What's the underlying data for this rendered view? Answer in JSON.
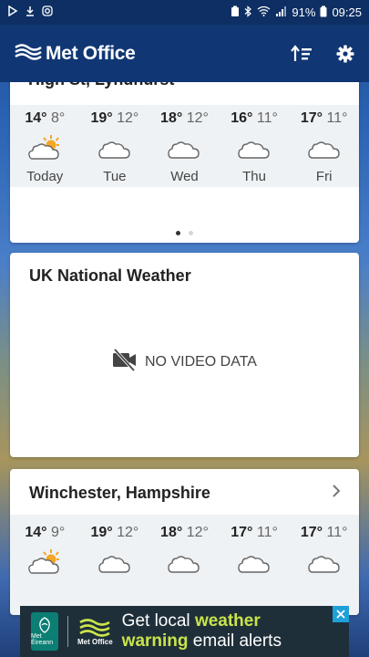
{
  "status_bar": {
    "left_icons": [
      "play-store-icon",
      "download-icon",
      "instagram-icon"
    ],
    "right_icons": [
      "battery-saver-icon",
      "bluetooth-icon",
      "wifi-icon",
      "signal-icon",
      "battery-icon"
    ],
    "battery": "91%",
    "time": "09:25"
  },
  "app_bar": {
    "title": "Met Office",
    "actions": [
      "sort-icon",
      "settings-icon"
    ]
  },
  "card1": {
    "header": "High St, Lyndhurst",
    "days": [
      {
        "hi": "14°",
        "lo": "8°",
        "icon": "sunny-intervals-icon",
        "name": "Today"
      },
      {
        "hi": "19°",
        "lo": "12°",
        "icon": "cloud-icon",
        "name": "Tue"
      },
      {
        "hi": "18°",
        "lo": "12°",
        "icon": "cloud-icon",
        "name": "Wed"
      },
      {
        "hi": "16°",
        "lo": "11°",
        "icon": "cloud-icon",
        "name": "Thu"
      },
      {
        "hi": "17°",
        "lo": "11°",
        "icon": "cloud-icon",
        "name": "Fri"
      }
    ],
    "page_dots": {
      "count": 2,
      "active": 0
    }
  },
  "card2": {
    "title": "UK National Weather",
    "no_video_label": "NO VIDEO DATA"
  },
  "card3": {
    "title": "Winchester, Hampshire",
    "days": [
      {
        "hi": "14°",
        "lo": "9°",
        "icon": "sunny-intervals-icon"
      },
      {
        "hi": "19°",
        "lo": "12°",
        "icon": "cloud-icon"
      },
      {
        "hi": "18°",
        "lo": "12°",
        "icon": "cloud-icon"
      },
      {
        "hi": "17°",
        "lo": "11°",
        "icon": "cloud-icon"
      },
      {
        "hi": "17°",
        "lo": "11°",
        "icon": "cloud-icon"
      }
    ]
  },
  "ad": {
    "badge_text": "Met Éireann",
    "logo_text": "Met Office",
    "line1_prefix": "Get local ",
    "line1_highlight": "weather",
    "line2_highlight": "warning",
    "line2_suffix": " email alerts"
  },
  "colors": {
    "app_bar": "#103774",
    "status_bar": "#0e2f63",
    "forecast_bg": "#eef2f5",
    "ad_highlight": "#c9e44b",
    "ad_close": "#1fa0d8"
  }
}
